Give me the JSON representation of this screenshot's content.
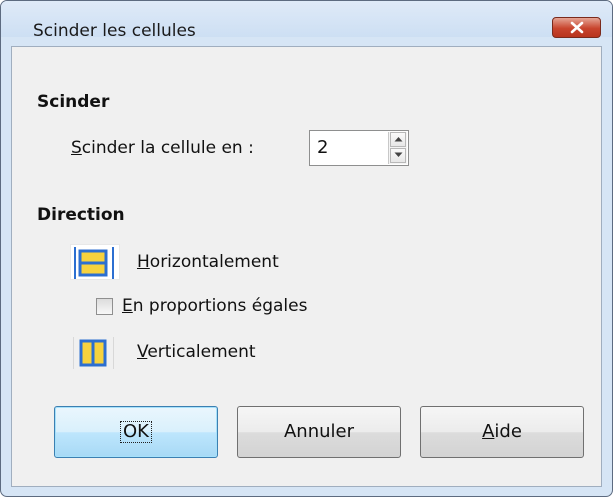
{
  "window": {
    "title": "Scinder les cellules"
  },
  "split": {
    "section_label": "Scinder",
    "field_label_prefix": "S",
    "field_label_rest": "cinder la cellule en :",
    "value": "2"
  },
  "direction": {
    "section_label": "Direction",
    "horizontal_prefix": "H",
    "horizontal_rest": "orizontalement",
    "equal_prefix": "E",
    "equal_rest": "n proportions égales",
    "vertical_prefix": "V",
    "vertical_rest": "erticalement",
    "selected": "horizontal",
    "equal_checked": false
  },
  "buttons": {
    "ok": "OK",
    "cancel": "Annuler",
    "help_prefix": "A",
    "help_rest": "ide"
  },
  "colors": {
    "icon_frame": "#2c6fd1",
    "icon_fill": "#f7d23e"
  }
}
